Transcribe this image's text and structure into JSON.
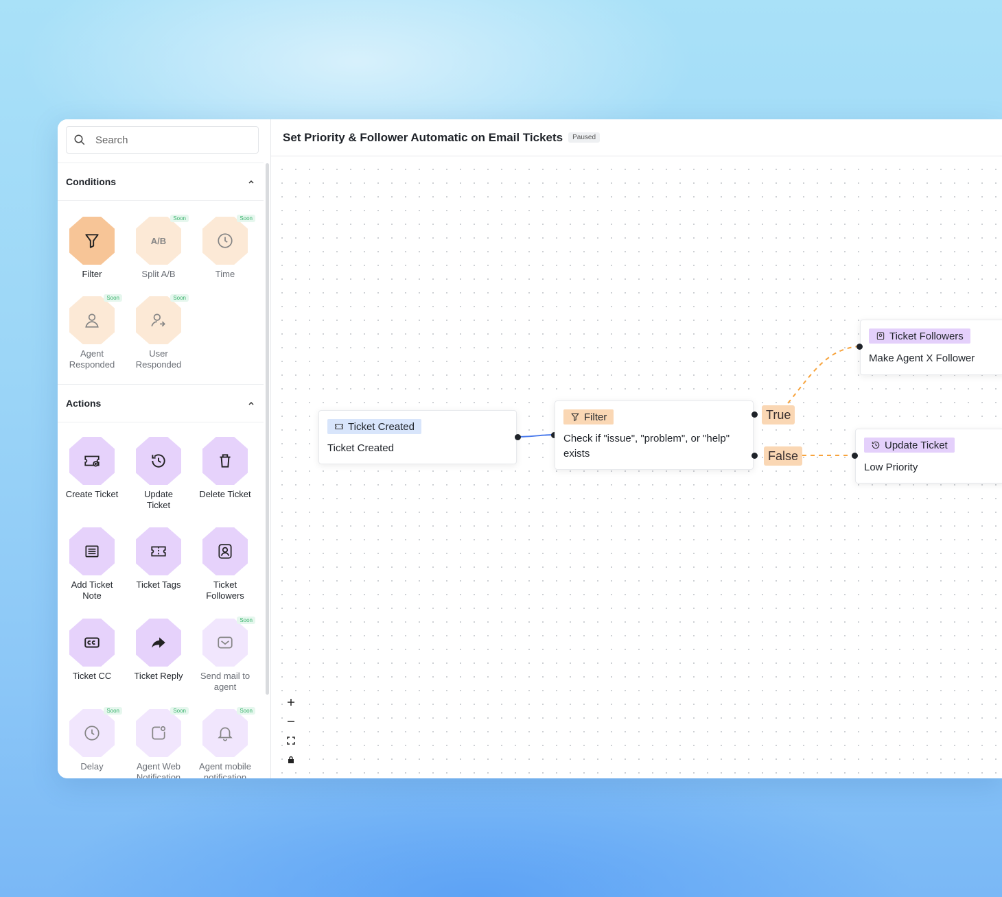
{
  "search": {
    "placeholder": "Search"
  },
  "conditions": {
    "heading": "Conditions",
    "items": [
      {
        "label": "Filter",
        "icon": "filter-icon",
        "soon": ""
      },
      {
        "label": "Split A/B",
        "icon": "split-ab-icon",
        "soon": "Soon",
        "glyph": "A/B"
      },
      {
        "label": "Time",
        "icon": "clock-icon",
        "soon": "Soon"
      },
      {
        "label": "Agent\nResponded",
        "icon": "agent-icon",
        "soon": "Soon"
      },
      {
        "label": "User\nResponded",
        "icon": "user-responded-icon",
        "soon": "Soon"
      }
    ]
  },
  "actions": {
    "heading": "Actions",
    "items": [
      {
        "label": "Create Ticket",
        "icon": "ticket-plus-icon",
        "soon": ""
      },
      {
        "label": "Update\nTicket",
        "icon": "history-icon",
        "soon": ""
      },
      {
        "label": "Delete Ticket",
        "icon": "trash-icon",
        "soon": ""
      },
      {
        "label": "Add Ticket\nNote",
        "icon": "note-icon",
        "soon": ""
      },
      {
        "label": "Ticket Tags",
        "icon": "ticket-icon",
        "soon": ""
      },
      {
        "label": "Ticket\nFollowers",
        "icon": "follower-icon",
        "soon": ""
      },
      {
        "label": "Ticket CC",
        "icon": "cc-icon",
        "soon": ""
      },
      {
        "label": "Ticket Reply",
        "icon": "reply-icon",
        "soon": ""
      },
      {
        "label": "Send mail to\nagent",
        "icon": "mail-icon",
        "soon": "Soon"
      },
      {
        "label": "Delay",
        "icon": "clock-icon",
        "soon": "Soon"
      },
      {
        "label": "Agent Web\nNotification",
        "icon": "web-notification-icon",
        "soon": "Soon"
      },
      {
        "label": "Agent mobile\nnotification",
        "icon": "bell-icon",
        "soon": "Soon"
      }
    ]
  },
  "header": {
    "title": "Set Priority & Follower Automatic on Email Tickets",
    "status": "Paused"
  },
  "nodes": {
    "trigger": {
      "tag": "Ticket Created",
      "body": "Ticket Created"
    },
    "filter": {
      "tag": "Filter",
      "body": "Check if \"issue\", \"problem\", or \"help\" exists"
    },
    "followers": {
      "tag": "Ticket Followers",
      "body": "Make Agent X Follower"
    },
    "update": {
      "tag": "Update Ticket",
      "body": "Low Priority"
    }
  },
  "branches": {
    "true": "True",
    "false": "False"
  },
  "colors": {
    "accent_orange": "#f7a33c",
    "edge_blue": "#4b7bec",
    "condition_fill": "#fad7b4",
    "action_fill": "#e6d2fb"
  }
}
